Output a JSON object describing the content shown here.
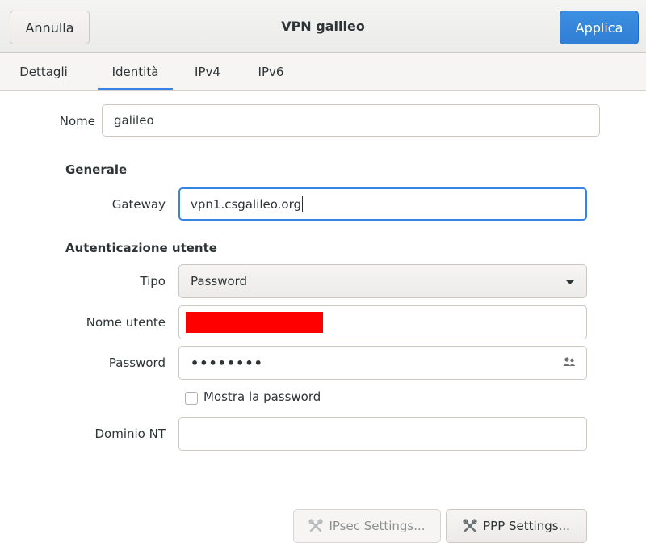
{
  "header": {
    "cancel_label": "Annulla",
    "title": "VPN galileo",
    "apply_label": "Applica"
  },
  "tabs": [
    {
      "label": "Dettagli"
    },
    {
      "label": "Identità"
    },
    {
      "label": "IPv4"
    },
    {
      "label": "IPv6"
    }
  ],
  "active_tab": "Identità",
  "form": {
    "name_label": "Nome",
    "name_value": "galileo",
    "general_section": "Generale",
    "gateway_label": "Gateway",
    "gateway_value": "vpn1.csgalileo.org",
    "auth_section": "Autenticazione utente",
    "type_label": "Tipo",
    "type_value": "Password",
    "username_label": "Nome utente",
    "password_label": "Password",
    "password_value": "••••••••",
    "show_password_label": "Mostra la password",
    "show_password_checked": false,
    "nt_domain_label": "Dominio NT",
    "nt_domain_value": ""
  },
  "buttons": {
    "ipsec_label": "IPsec Settings...",
    "ipsec_enabled": false,
    "ppp_label": "PPP Settings..."
  },
  "colors": {
    "accent": "#3584e4",
    "apply_button": "#3584e4",
    "redaction": "#ff0000"
  },
  "icons": {
    "password_field": "users-icon",
    "settings_buttons": "tools-icon"
  }
}
